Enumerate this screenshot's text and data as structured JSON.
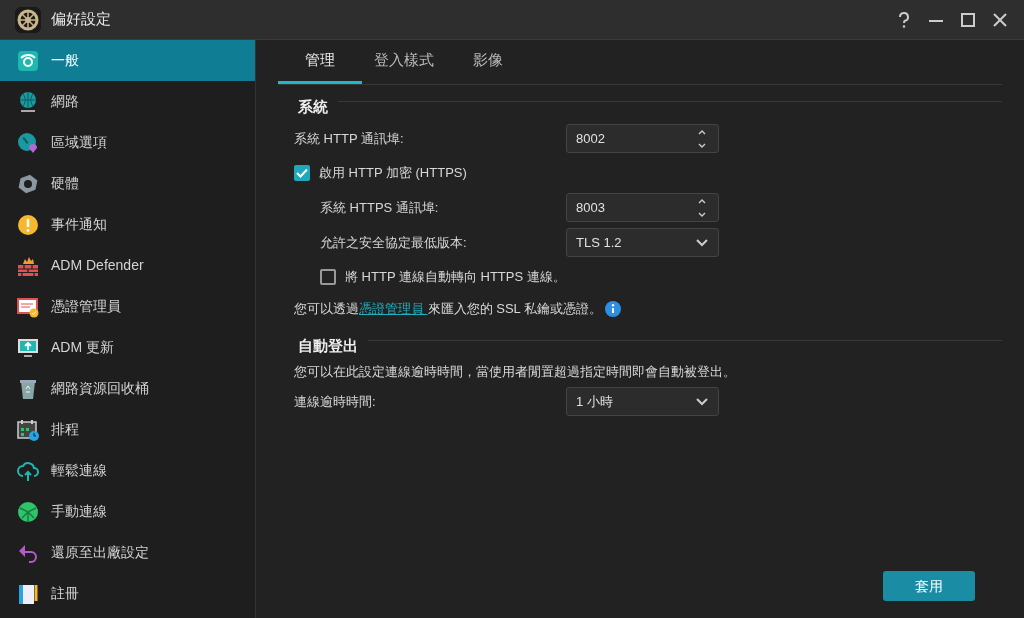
{
  "window": {
    "title": "偏好設定"
  },
  "sidebar": {
    "items": [
      {
        "label": "一般",
        "selected": true
      },
      {
        "label": "網路",
        "selected": false
      },
      {
        "label": "區域選項",
        "selected": false
      },
      {
        "label": "硬體",
        "selected": false
      },
      {
        "label": "事件通知",
        "selected": false
      },
      {
        "label": "ADM Defender",
        "selected": false
      },
      {
        "label": "憑證管理員",
        "selected": false
      },
      {
        "label": "ADM 更新",
        "selected": false
      },
      {
        "label": "網路資源回收桶",
        "selected": false
      },
      {
        "label": "排程",
        "selected": false
      },
      {
        "label": "輕鬆連線",
        "selected": false
      },
      {
        "label": "手動連線",
        "selected": false
      },
      {
        "label": "還原至出廠設定",
        "selected": false
      },
      {
        "label": "註冊",
        "selected": false
      }
    ]
  },
  "tabs": [
    {
      "label": "管理",
      "selected": true
    },
    {
      "label": "登入樣式",
      "selected": false
    },
    {
      "label": "影像",
      "selected": false
    }
  ],
  "sections": [
    {
      "title": "系統",
      "rows": [
        {
          "kind": "spinner",
          "label": "系統 HTTP 通訊埠:",
          "value": "8002"
        },
        {
          "kind": "checkbox",
          "label": "啟用 HTTP 加密 (HTTPS)",
          "checked": true,
          "children": [
            {
              "kind": "spinner",
              "label": "系統 HTTPS 通訊埠:",
              "value": "8003"
            },
            {
              "kind": "select",
              "label": "允許之安全協定最低版本:",
              "value": "TLS 1.2"
            },
            {
              "kind": "checkbox",
              "label": "將 HTTP 連線自動轉向 HTTPS 連線。",
              "checked": false
            }
          ]
        },
        {
          "kind": "note",
          "before": "您可以透過",
          "link": "憑證管理員 ",
          "after": "來匯入您的 SSL 私鑰或憑證。"
        }
      ]
    },
    {
      "title": "自動登出",
      "rows": [
        {
          "kind": "text",
          "text": "您可以在此設定連線逾時時間，當使用者閒置超過指定時間即會自動被登出。"
        },
        {
          "kind": "select",
          "label": "連線逾時時間:",
          "value": "1 小時"
        }
      ]
    }
  ],
  "apply_button": "套用"
}
